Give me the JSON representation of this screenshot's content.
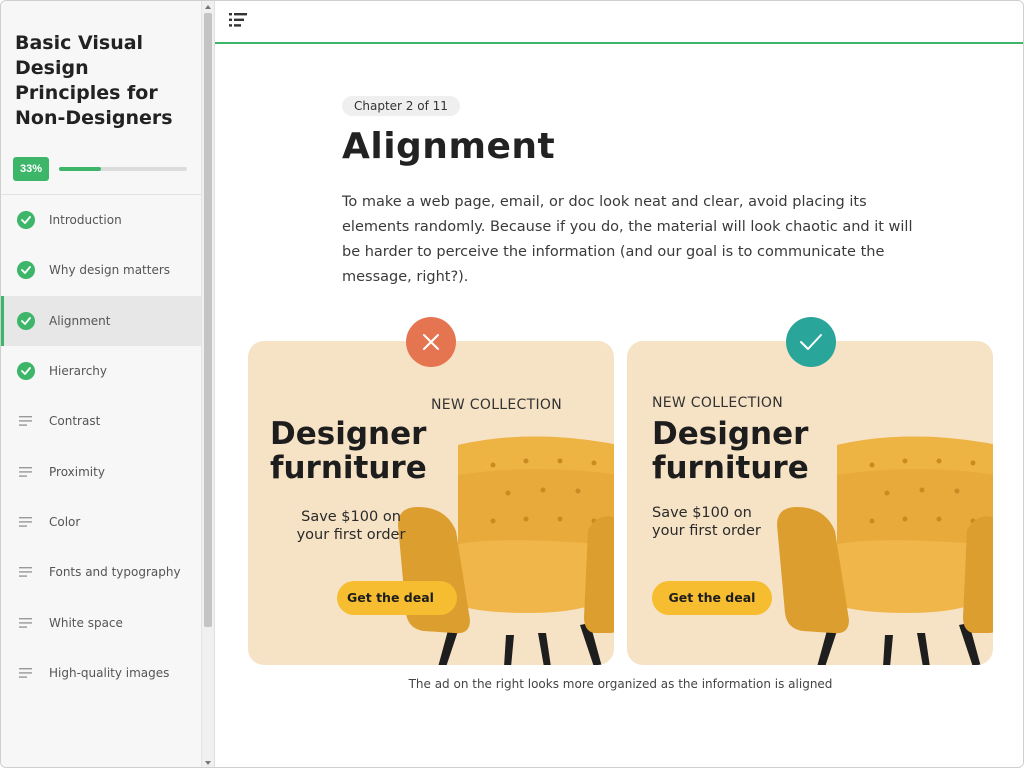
{
  "course": {
    "title": "Basic Visual Design Principles for Non-Designers",
    "progress_label": "33%",
    "progress_value": 0.33
  },
  "sidebar": {
    "items": [
      {
        "label": "Introduction",
        "completed": true,
        "active": false,
        "icon": "check-circle-icon"
      },
      {
        "label": "Why design matters",
        "completed": true,
        "active": false,
        "icon": "check-circle-icon"
      },
      {
        "label": "Alignment",
        "completed": true,
        "active": true,
        "icon": "check-circle-icon"
      },
      {
        "label": "Hierarchy",
        "completed": true,
        "active": false,
        "icon": "check-circle-icon"
      },
      {
        "label": "Contrast",
        "completed": false,
        "active": false,
        "icon": "text-lines-icon"
      },
      {
        "label": "Proximity",
        "completed": false,
        "active": false,
        "icon": "text-lines-icon"
      },
      {
        "label": "Color",
        "completed": false,
        "active": false,
        "icon": "text-lines-icon"
      },
      {
        "label": "Fonts and typography",
        "completed": false,
        "active": false,
        "icon": "text-lines-icon"
      },
      {
        "label": "White space",
        "completed": false,
        "active": false,
        "icon": "text-lines-icon"
      },
      {
        "label": "High-quality images",
        "completed": false,
        "active": false,
        "icon": "text-lines-icon"
      }
    ]
  },
  "topbar": {
    "menu_icon": "list-menu-icon"
  },
  "lesson": {
    "chapter_label": "Chapter 2 of 11",
    "title": "Alignment",
    "intro": "To make a web page, email, or doc look neat and clear, avoid placing its elements randomly. Because if you do, the material will look chaotic and it will be harder to perceive the information (and our goal is to communicate the message, right?)."
  },
  "ads": {
    "bad": {
      "marker_icon": "x-mark-icon",
      "kicker": "NEW COLLECTION",
      "headline_1": "Designer",
      "headline_2": "furniture",
      "offer_1": "Save $100 on",
      "offer_2": "your first order",
      "cta": "Get the deal"
    },
    "good": {
      "marker_icon": "check-mark-icon",
      "kicker": "NEW COLLECTION",
      "headline_1": "Designer",
      "headline_2": "furniture",
      "offer_1": "Save $100 on",
      "offer_2": "your first order",
      "cta": "Get the deal"
    },
    "caption": "The ad on the right looks more organized as the information is aligned"
  },
  "colors": {
    "accent_green": "#3db66a",
    "bad_marker": "#e57550",
    "good_marker": "#2aa59a",
    "ad_background": "#f6e3c6",
    "cta_yellow": "#f5bd2f",
    "chair_yellow": "#e8aa3a"
  }
}
